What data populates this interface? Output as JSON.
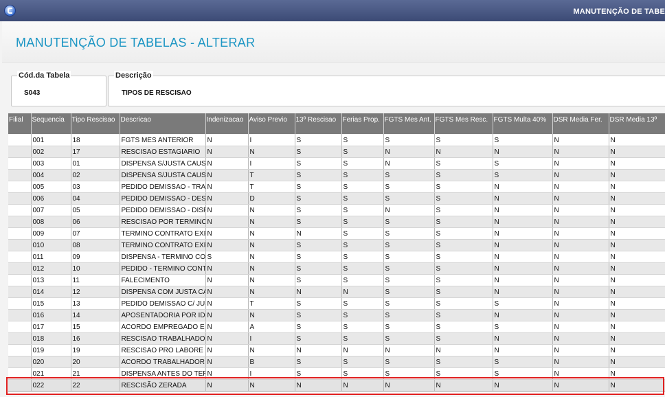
{
  "window": {
    "title": "MANUTENÇÃO DE TABE"
  },
  "page": {
    "heading": "MANUTENÇÃO DE TABELAS - ALTERAR"
  },
  "fields": {
    "codigo": {
      "label": "Cód.da Tabela",
      "value": "S043"
    },
    "descricao": {
      "label": "Descrição",
      "value": "TIPOS DE RESCISAO"
    }
  },
  "grid": {
    "columns": [
      "Filial",
      "Sequencia",
      "Tipo Rescisao",
      "Descricao",
      "Indenizacao",
      "Aviso Previo",
      "13º Rescisao",
      "Ferias Prop.",
      "FGTS Mes Ant.",
      "FGTS Mes Resc.",
      "FGTS Multa 40%",
      "DSR Media Fer.",
      "DSR Media 13º"
    ],
    "rows": [
      [
        "",
        "001",
        "18",
        "FGTS MES ANTERIOR",
        "N",
        "I",
        "S",
        "S",
        "S",
        "S",
        "S",
        "N",
        "N"
      ],
      [
        "",
        "002",
        "17",
        "RESCISAO ESTAGIARIO",
        "N",
        "N",
        "S",
        "S",
        "N",
        "N",
        "N",
        "N",
        "N"
      ],
      [
        "",
        "003",
        "01",
        "DISPENSA S/JUSTA CAUSA",
        "N",
        "I",
        "S",
        "S",
        "N",
        "S",
        "S",
        "N",
        "N"
      ],
      [
        "",
        "004",
        "02",
        "DISPENSA S/JUSTA CAUSA",
        "N",
        "T",
        "S",
        "S",
        "S",
        "S",
        "S",
        "N",
        "N"
      ],
      [
        "",
        "005",
        "03",
        "PEDIDO DEMISSAO - TRAB",
        "N",
        "T",
        "S",
        "S",
        "S",
        "S",
        "N",
        "N",
        "N"
      ],
      [
        "",
        "006",
        "04",
        "PEDIDO DEMISSAO - DESC",
        "N",
        "D",
        "S",
        "S",
        "S",
        "S",
        "N",
        "N",
        "N"
      ],
      [
        "",
        "007",
        "05",
        "PEDIDO DEMISSAO - DISP",
        "N",
        "N",
        "S",
        "S",
        "N",
        "S",
        "N",
        "N",
        "N"
      ],
      [
        "",
        "008",
        "06",
        "RESCISAO POR TERMINO",
        "N",
        "N",
        "S",
        "S",
        "S",
        "S",
        "N",
        "N",
        "N"
      ],
      [
        "",
        "009",
        "07",
        "TERMINO CONTRATO EXP",
        "N",
        "N",
        "N",
        "S",
        "S",
        "S",
        "N",
        "N",
        "N"
      ],
      [
        "",
        "010",
        "08",
        "TERMINO CONTRATO EXP",
        "N",
        "N",
        "S",
        "S",
        "S",
        "S",
        "N",
        "N",
        "N"
      ],
      [
        "",
        "011",
        "09",
        "DISPENSA - TERMINO CON",
        "S",
        "N",
        "S",
        "S",
        "S",
        "S",
        "N",
        "N",
        "N"
      ],
      [
        "",
        "012",
        "10",
        "PEDIDO - TERMINO CONT",
        "N",
        "N",
        "S",
        "S",
        "S",
        "S",
        "N",
        "N",
        "N"
      ],
      [
        "",
        "013",
        "11",
        "FALECIMENTO",
        "N",
        "N",
        "S",
        "S",
        "S",
        "S",
        "N",
        "N",
        "N"
      ],
      [
        "",
        "014",
        "12",
        "DISPENSA COM JUSTA CA",
        "N",
        "N",
        "N",
        "N",
        "S",
        "S",
        "N",
        "N",
        "N"
      ],
      [
        "",
        "015",
        "13",
        "PEDIDO DEMISSAO C/ JUS",
        "N",
        "T",
        "S",
        "S",
        "S",
        "S",
        "S",
        "N",
        "N"
      ],
      [
        "",
        "016",
        "14",
        "APOSENTADORIA POR ID",
        "N",
        "N",
        "S",
        "S",
        "S",
        "S",
        "N",
        "N",
        "N"
      ],
      [
        "",
        "017",
        "15",
        "ACORDO EMPREGADO E",
        "N",
        "A",
        "S",
        "S",
        "S",
        "S",
        "S",
        "N",
        "N"
      ],
      [
        "",
        "018",
        "16",
        "RESCISAO TRABALHADO",
        "N",
        "I",
        "S",
        "S",
        "S",
        "S",
        "N",
        "N",
        "N"
      ],
      [
        "",
        "019",
        "19",
        "RESCISAO PRO LABORE",
        "N",
        "N",
        "N",
        "N",
        "N",
        "N",
        "N",
        "N",
        "N"
      ],
      [
        "",
        "020",
        "20",
        "ACORDO TRABALHADOR",
        "N",
        "B",
        "S",
        "S",
        "S",
        "S",
        "S",
        "N",
        "N"
      ],
      [
        "",
        "021",
        "21",
        "DISPENSA ANTES DO TER",
        "N",
        "I",
        "S",
        "S",
        "S",
        "S",
        "S",
        "N",
        "N"
      ],
      [
        "",
        "022",
        "22",
        "RESCISÃO ZERADA",
        "N",
        "N",
        "N",
        "N",
        "N",
        "N",
        "N",
        "N",
        "N"
      ]
    ]
  },
  "colors": {
    "accent": "#1d96c4",
    "highlight": "#e02020",
    "grid_header": "#7a7a7a"
  }
}
